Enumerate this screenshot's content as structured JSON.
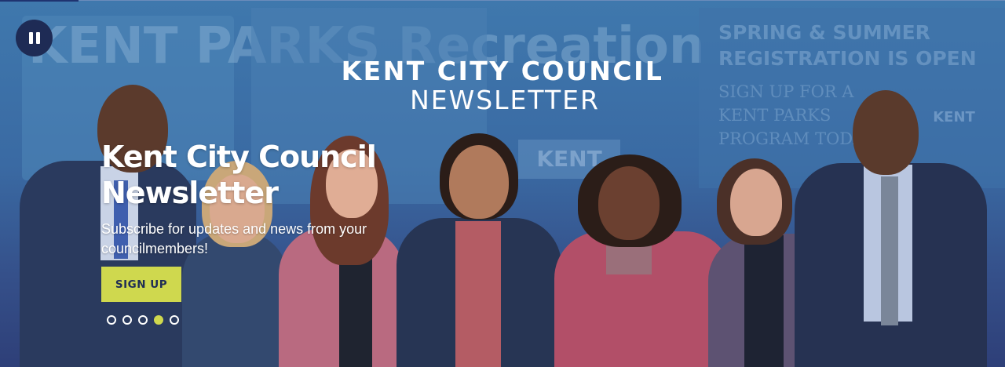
{
  "carousel": {
    "pause_icon": "pause-icon",
    "logo_line1": "KENT CITY COUNCIL",
    "logo_line2": "NEWSLETTER",
    "headline": "Kent City Council Newsletter",
    "subtitle": "Subscribe for updates and news from your councilmembers!",
    "cta_label": "SIGN UP",
    "slide_count": 5,
    "active_slide": 4,
    "background_text": {
      "parks_sign": "KENT PARKS Recreation",
      "poster_heading": "SPRING & SUMMER REGISTRATION IS OPEN",
      "poster_sub": "SIGN UP FOR A KENT PARKS PROGRAM TODAY",
      "kent_sign": "KENT",
      "kent_logo": "KENT"
    }
  },
  "colors": {
    "accent": "#cfd84e",
    "dark_navy": "#1e2b55",
    "button_text": "#1f2d55"
  }
}
